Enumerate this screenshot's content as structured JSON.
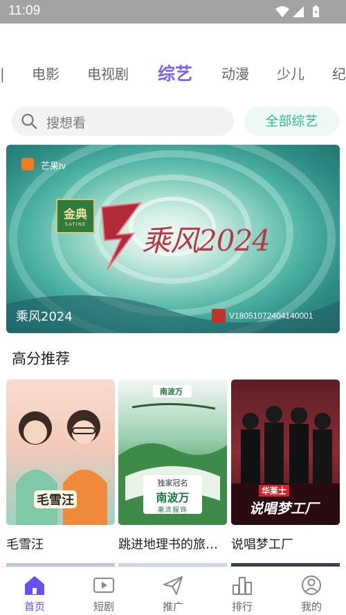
{
  "status_bar": {
    "time": "11:09",
    "icons": [
      "wifi-icon",
      "signal-icon",
      "battery-icon"
    ]
  },
  "category_tabs": [
    {
      "label": "电影",
      "active": false
    },
    {
      "label": "电视剧",
      "active": false
    },
    {
      "label": "综艺",
      "active": true
    },
    {
      "label": "动漫",
      "active": false
    },
    {
      "label": "少儿",
      "active": false
    },
    {
      "label": "纪",
      "active": false
    }
  ],
  "search": {
    "placeholder": "搜想看",
    "all_button": "全部综艺"
  },
  "banner": {
    "title": "乘风2024",
    "logo_text": "芒果tv",
    "sponsor_name": "金典",
    "sponsor_sub": "SATINE",
    "show_art": "乘风2024",
    "watermark": "V18051072404140001"
  },
  "section": {
    "title": "高分推荐"
  },
  "cards": [
    {
      "title": "毛雪汪",
      "art_title": "毛雪汪"
    },
    {
      "title": "跳进地理书的旅…",
      "brand_label": "独家冠名",
      "brand_name": "南波万",
      "brand_sub": "潮流服饰",
      "top_brand": "南波万"
    },
    {
      "title": "说唱梦工厂",
      "art_title": "说唱梦工厂",
      "top_brand": "华莱士"
    }
  ],
  "bottom_nav": [
    {
      "label": "首页",
      "icon": "home-icon",
      "active": true
    },
    {
      "label": "短剧",
      "icon": "play-icon",
      "active": false
    },
    {
      "label": "推广",
      "icon": "send-icon",
      "active": false
    },
    {
      "label": "排行",
      "icon": "ranking-icon",
      "active": false
    },
    {
      "label": "我的",
      "icon": "profile-icon",
      "active": false
    }
  ],
  "colors": {
    "accent": "#7c5ff5",
    "nav_active": "#6a4ff2",
    "all_button_text": "#2ebd89",
    "status_bar": "#a3a3a3"
  }
}
